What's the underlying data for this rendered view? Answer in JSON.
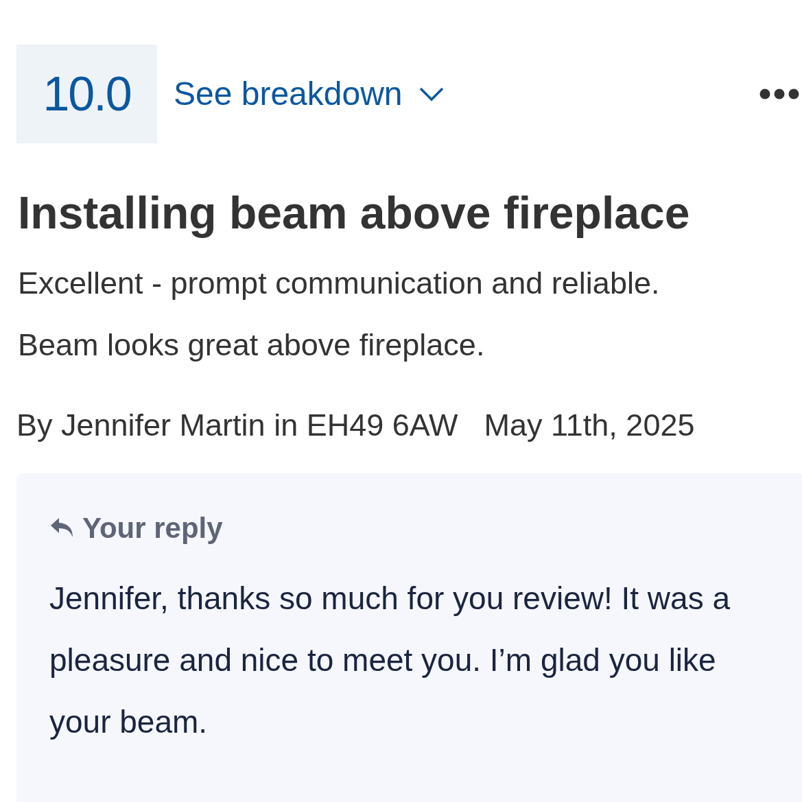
{
  "score": "10.0",
  "breakdown_link": {
    "label": "See breakdown",
    "expanded": false
  },
  "title": "Installing beam above fireplace",
  "body": [
    "Excellent - prompt communication and reliable.",
    "Beam looks great above fireplace."
  ],
  "byline": {
    "author": "By Jennifer Martin in EH49 6AW",
    "date": "May 11th, 2025"
  },
  "reply": {
    "heading": "Your reply",
    "text": "Jennifer, thanks so much for you review! It was a pleasure and nice to meet you. I’m glad you like your beam."
  }
}
